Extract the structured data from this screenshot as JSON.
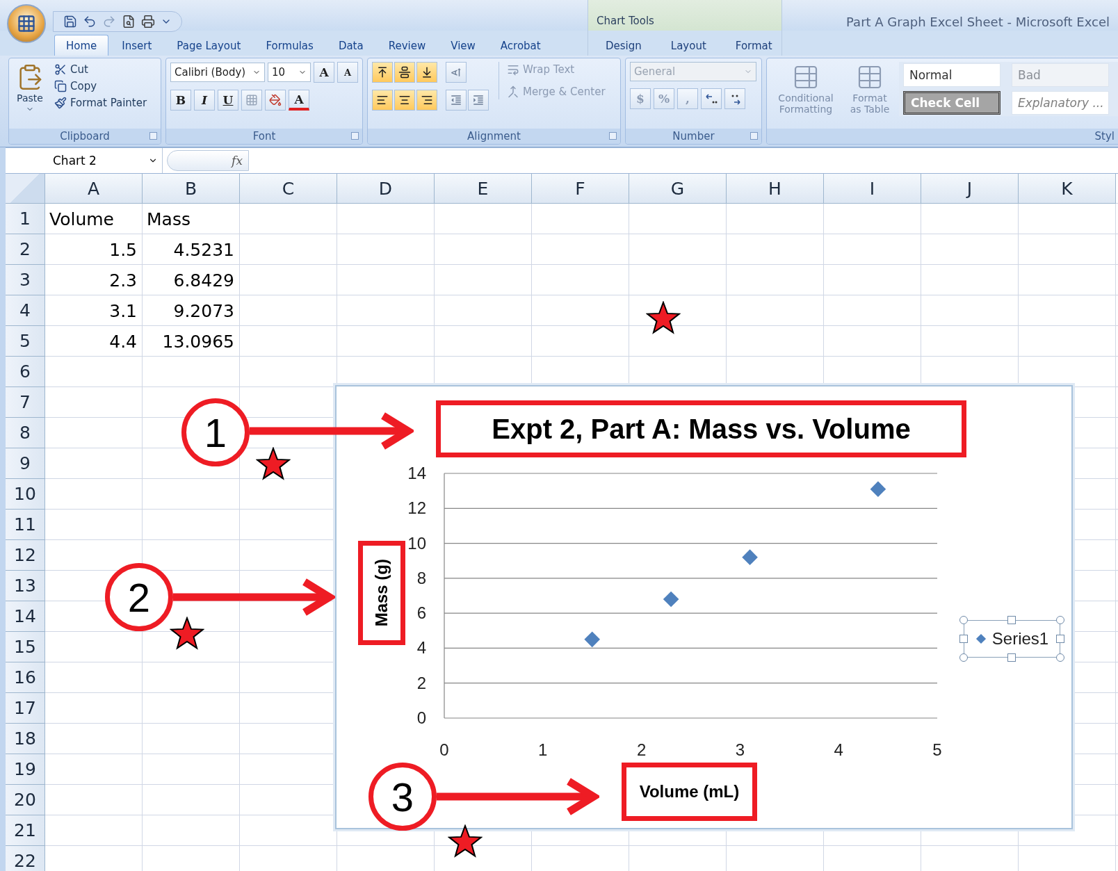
{
  "window": {
    "title": "Part A Graph Excel Sheet - Microsoft Excel",
    "contextual_group": "Chart Tools"
  },
  "tabs": [
    {
      "label": "Home",
      "selected": true,
      "contextual": false
    },
    {
      "label": "Insert",
      "selected": false,
      "contextual": false
    },
    {
      "label": "Page Layout",
      "selected": false,
      "contextual": false
    },
    {
      "label": "Formulas",
      "selected": false,
      "contextual": false
    },
    {
      "label": "Data",
      "selected": false,
      "contextual": false
    },
    {
      "label": "Review",
      "selected": false,
      "contextual": false
    },
    {
      "label": "View",
      "selected": false,
      "contextual": false
    },
    {
      "label": "Acrobat",
      "selected": false,
      "contextual": false
    },
    {
      "label": "Design",
      "selected": false,
      "contextual": true
    },
    {
      "label": "Layout",
      "selected": false,
      "contextual": true
    },
    {
      "label": "Format",
      "selected": false,
      "contextual": true
    }
  ],
  "ribbon": {
    "clipboard": {
      "label": "Clipboard",
      "paste": "Paste",
      "commands": [
        {
          "label": "Cut",
          "kind": "cut"
        },
        {
          "label": "Copy",
          "kind": "copy"
        },
        {
          "label": "Format Painter",
          "kind": "painter"
        }
      ]
    },
    "font": {
      "label": "Font",
      "face": "Calibri (Body)",
      "size": "10",
      "grow": "A",
      "shrink": "A",
      "bold": "B",
      "italic": "I",
      "underline": "U",
      "font_color": "A"
    },
    "alignment": {
      "label": "Alignment",
      "commands": [
        {
          "label": "Wrap Text",
          "kind": "wrap",
          "disabled": true
        },
        {
          "label": "Merge & Center",
          "kind": "merge",
          "disabled": true
        }
      ]
    },
    "number": {
      "label": "Number",
      "format": "General",
      "disabled": true,
      "currency": "$",
      "percent": "%",
      "comma": ","
    },
    "styles": {
      "label": "Styl",
      "commands": [
        {
          "label": "Conditional Formatting",
          "kind": "conditional"
        },
        {
          "label": "Format as Table",
          "kind": "table"
        }
      ],
      "cell_styles": [
        {
          "label": "Normal",
          "kind": "normal"
        },
        {
          "label": "Bad",
          "kind": "bad"
        },
        {
          "label": "Check Cell",
          "kind": "check"
        },
        {
          "label": "Explanatory ...",
          "kind": "explanatory"
        }
      ]
    }
  },
  "formula_bar": {
    "name_box": "Chart 2",
    "fx": "fx"
  },
  "sheet": {
    "columns": [
      "A",
      "B",
      "C",
      "D",
      "E",
      "F",
      "G",
      "H",
      "I",
      "J",
      "K"
    ],
    "rows": [
      {
        "header": "1",
        "cells": [
          {
            "value": "Volume",
            "kind": "text"
          },
          {
            "value": "Mass",
            "kind": "text"
          }
        ]
      },
      {
        "header": "2",
        "cells": [
          {
            "value": "1.5",
            "kind": "number"
          },
          {
            "value": "4.5231",
            "kind": "number"
          }
        ]
      },
      {
        "header": "3",
        "cells": [
          {
            "value": "2.3",
            "kind": "number"
          },
          {
            "value": "6.8429",
            "kind": "number"
          }
        ]
      },
      {
        "header": "4",
        "cells": [
          {
            "value": "3.1",
            "kind": "number"
          },
          {
            "value": "9.2073",
            "kind": "number"
          }
        ]
      },
      {
        "header": "5",
        "cells": [
          {
            "value": "4.4",
            "kind": "number"
          },
          {
            "value": "13.0965",
            "kind": "number"
          }
        ]
      },
      {
        "header": "6"
      },
      {
        "header": "7"
      },
      {
        "header": "8"
      },
      {
        "header": "9"
      },
      {
        "header": "10"
      },
      {
        "header": "11"
      },
      {
        "header": "12"
      },
      {
        "header": "13"
      },
      {
        "header": "14"
      },
      {
        "header": "15"
      },
      {
        "header": "16"
      },
      {
        "header": "17"
      },
      {
        "header": "18"
      },
      {
        "header": "19"
      },
      {
        "header": "20"
      },
      {
        "header": "21"
      },
      {
        "header": "22"
      }
    ]
  },
  "chart": {
    "chart_data": {
      "type": "scatter",
      "title": "Expt 2, Part A: Mass vs. Volume",
      "xlabel": "Volume (mL)",
      "ylabel": "Mass (g)",
      "x": [
        1.5,
        2.3,
        3.1,
        4.4
      ],
      "series": [
        {
          "name": "Series1",
          "color": "#4f81bd",
          "values": [
            4.5,
            6.8,
            9.2,
            13.1
          ]
        }
      ],
      "xlim": [
        0,
        5
      ],
      "ylim": [
        0,
        14
      ],
      "xticks": [
        0,
        1,
        2,
        3,
        4,
        5
      ],
      "yticks": [
        0,
        2,
        4,
        6,
        8,
        10,
        12,
        14
      ],
      "grid": true
    }
  },
  "annotations": [
    {
      "label": "1"
    },
    {
      "label": "2"
    },
    {
      "label": "3"
    }
  ]
}
